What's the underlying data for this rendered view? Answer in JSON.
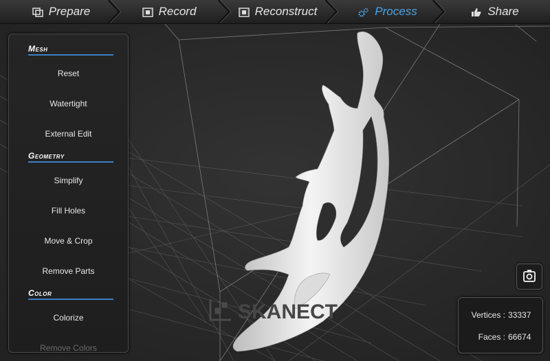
{
  "steps": [
    {
      "label": "Prepare",
      "icon": "prepare-icon",
      "active": false
    },
    {
      "label": "Record",
      "icon": "film-icon",
      "active": false
    },
    {
      "label": "Reconstruct",
      "icon": "film-icon",
      "active": false
    },
    {
      "label": "Process",
      "icon": "gears-icon",
      "active": true
    },
    {
      "label": "Share",
      "icon": "thumbs-up-icon",
      "active": false
    }
  ],
  "panel": {
    "mesh_heading": "Mesh",
    "mesh_items": [
      "Reset",
      "Watertight",
      "External Edit"
    ],
    "geometry_heading": "Geometry",
    "geometry_items": [
      "Simplify",
      "Fill Holes",
      "Move & Crop",
      "Remove Parts"
    ],
    "color_heading": "Color",
    "color_items": [
      "Colorize",
      "Remove Colors"
    ]
  },
  "stats": {
    "vertices_label": "Vertices :",
    "vertices_value": "33337",
    "faces_label": "Faces :",
    "faces_value": "66674"
  },
  "watermark": {
    "text": "SKANECT"
  },
  "colors": {
    "accent": "#4aa3e6",
    "underline": "#3d7fc4",
    "background": "#2a2a2a"
  }
}
